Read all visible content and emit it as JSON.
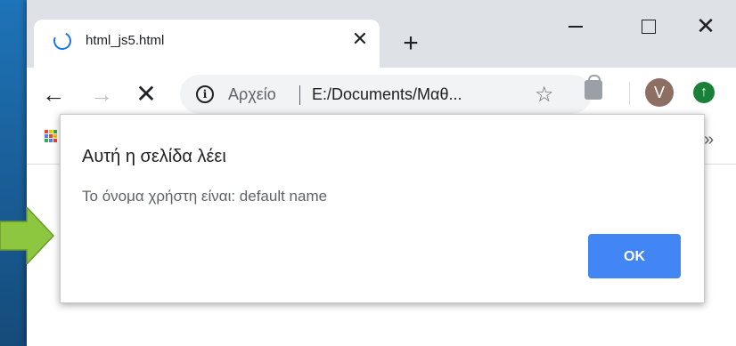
{
  "browser": {
    "tab": {
      "title": "html_js5.html",
      "close_glyph": "✕",
      "loading_icon": "spinner-icon"
    },
    "new_tab_glyph": "+",
    "window_controls": {
      "minimize": "minimize-icon",
      "maximize": "maximize-icon",
      "close_glyph": "✕"
    },
    "toolbar": {
      "back_glyph": "←",
      "forward_glyph": "→",
      "stop_glyph": "✕",
      "info_glyph": "i",
      "scheme_label": "Αρχείο",
      "url": "E:/Documents/Μαθ...",
      "star_glyph": "☆",
      "avatar_letter": "V",
      "update_glyph": "↑"
    },
    "bookmarks": {
      "overflow_glyph": "»",
      "apps_colors": [
        "#ea4335",
        "#fbbc04",
        "#34a853",
        "#4285f4",
        "#ea4335",
        "#fbbc04",
        "#34a853",
        "#4285f4",
        "#ea4335"
      ]
    }
  },
  "dialog": {
    "title": "Αυτή η σελίδα λέει",
    "message": "Το όνομα χρήστη είναι: default name",
    "ok_label": "OK"
  },
  "colors": {
    "accent": "#4285f4",
    "arrow": "#8dc63f"
  }
}
